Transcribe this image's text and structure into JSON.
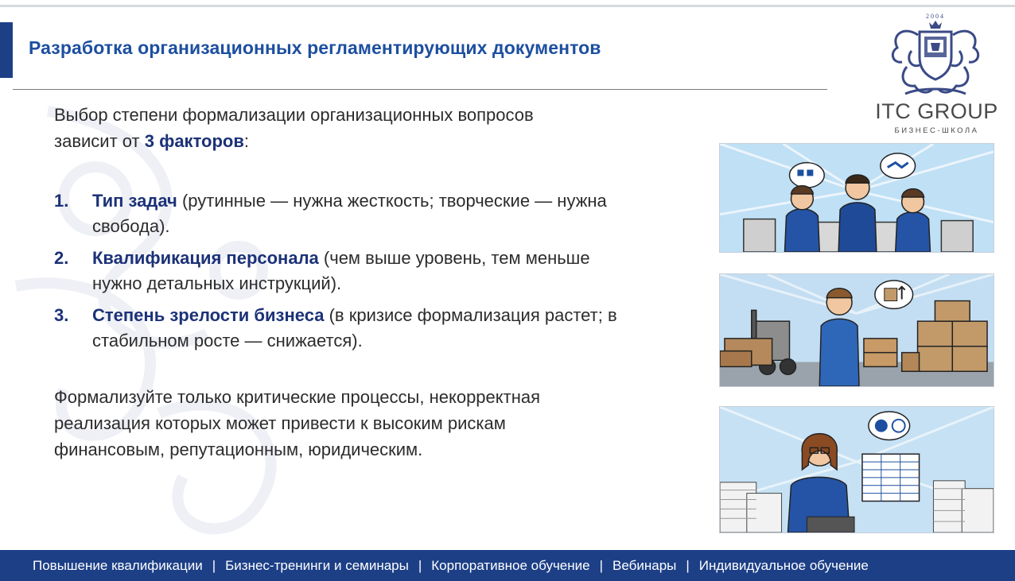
{
  "title": "Разработка организационных регламентирующих документов",
  "logo": {
    "year": "2004",
    "name": "ITC GROUP",
    "subtitle": "БИЗНЕС-ШКОЛА"
  },
  "intro": {
    "text": "Выбор степени формализации организационных вопросов зависит от ",
    "emphasis": "3 факторов",
    "tail": ":"
  },
  "factors": [
    {
      "number": "1.",
      "heading": "Тип задач",
      "detail": " (рутинные — нужна жесткость; творческие — нужна свобода)."
    },
    {
      "number": "2.",
      "heading": "Квалификация персонала",
      "detail": " (чем выше уровень, тем меньше нужно детальных инструкций)."
    },
    {
      "number": "3.",
      "heading": "Степень зрелости бизнеса",
      "detail": " (в кризисе формализация растет; в стабильном росте — снижается)."
    }
  ],
  "outro": "Формализуйте только критические процессы, некорректная реализация которых может привести к высоким рискам финансовым, репутационным, юридическим.",
  "footer": {
    "items": [
      "Повышение квалификации",
      "Бизнес-тренинги и семинары",
      "Корпоративное обучение",
      "Вебинары",
      "Индивидуальное обучение"
    ],
    "separator": "|"
  },
  "colors": {
    "accent": "#1c3f86",
    "title": "#1d4fa0",
    "emphasis": "#1c3278",
    "body_text": "#2c2c2c"
  },
  "illustrations": [
    {
      "icon": "meeting-illustration"
    },
    {
      "icon": "warehouse-illustration"
    },
    {
      "icon": "accountant-illustration"
    }
  ]
}
